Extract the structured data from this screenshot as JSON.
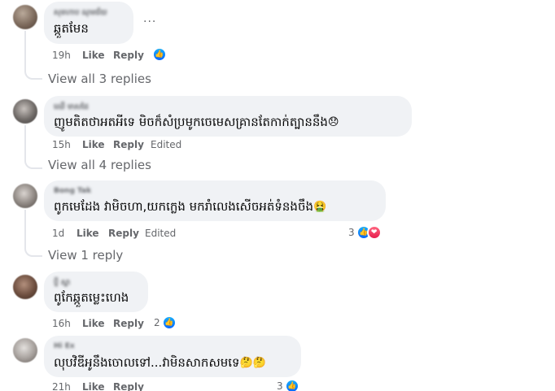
{
  "comments": [
    {
      "author": "សុខហាប ណុមជ័យ",
      "text": "ឆ្កួតមែន",
      "emoji": "",
      "time": "19h",
      "like_label": "Like",
      "reply_label": "Reply",
      "edited_label": "",
      "reaction_count": "",
      "more_label": "...",
      "view_replies": "View all 3 replies"
    },
    {
      "author": "ឈើ មាសដៃ",
      "text": "ញូមតិតថាអតអីទេ មិចក៏សំប្រមូកចេមេសគ្រានតែកាក់ត្បាននឹង",
      "emoji": "😞",
      "time": "15h",
      "like_label": "Like",
      "reply_label": "Reply",
      "edited_label": "Edited",
      "reaction_count": "",
      "view_replies": "View all 4 replies"
    },
    {
      "author": "Bong Tak",
      "text": "ពូកមេដែង វាមិចហា,យកក្លេង មករាំលេងសើចអត់ទំនងចឹង",
      "emoji": "🤮",
      "time": "1d",
      "like_label": "Like",
      "reply_label": "Reply",
      "edited_label": "Edited",
      "reaction_count": "3",
      "view_replies": "View 1 reply"
    },
    {
      "author": "ប្ញី ស្នា",
      "text": "ពូកែឆ្កួតម្លេះហេង",
      "emoji": "",
      "time": "16h",
      "like_label": "Like",
      "reply_label": "Reply",
      "edited_label": "",
      "reaction_count": "2"
    },
    {
      "author": "Hi Ex",
      "text": "លុបវិឌីអូនឹងចោលទៅ...វាមិនសាកសមទេ",
      "emoji": "🤔🤔",
      "time": "21h",
      "like_label": "Like",
      "reply_label": "Reply",
      "edited_label": "",
      "reaction_count": "3"
    }
  ],
  "icons": {
    "like": "like-icon",
    "love": "love-icon",
    "more": "more-options-icon"
  },
  "colors": {
    "bubble": "#f0f2f5",
    "meta": "#65676b",
    "like_blue": "#0866ff",
    "love_red": "#e61e4d"
  }
}
